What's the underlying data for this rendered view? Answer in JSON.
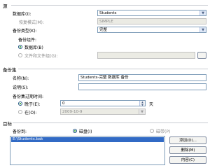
{
  "source": {
    "header": "源",
    "database_label": "数据库(I):",
    "database_value": "Students",
    "recovery_label": "恢复模式(M):",
    "recovery_value": "SIMPLE",
    "backup_type_label": "备份类型(K):",
    "backup_type_value": "完整",
    "component_label": "备份组件:",
    "component_database": "数据库(B)",
    "component_files": "文件和文件组(G):"
  },
  "backup_set": {
    "header": "备份集",
    "name_label": "名称(N):",
    "name_value": "Students-完整 数据库 备份",
    "desc_label": "说明(S):",
    "desc_value": "",
    "expire_label": "备份集过期时间:",
    "after_label": "晚于(E):",
    "after_value": "0",
    "after_unit": "天",
    "on_label": "在(O):",
    "on_value": "2009-10-9"
  },
  "destination": {
    "header": "目标",
    "backup_to_label": "备份到:",
    "disk_label": "磁盘(I)",
    "tape_label": "磁带(P)",
    "list_items": [
      "E:\\Students.bak"
    ],
    "add_button": "添加(D)...",
    "remove_button": "删除(M)",
    "contents_button": "内容(C)"
  }
}
